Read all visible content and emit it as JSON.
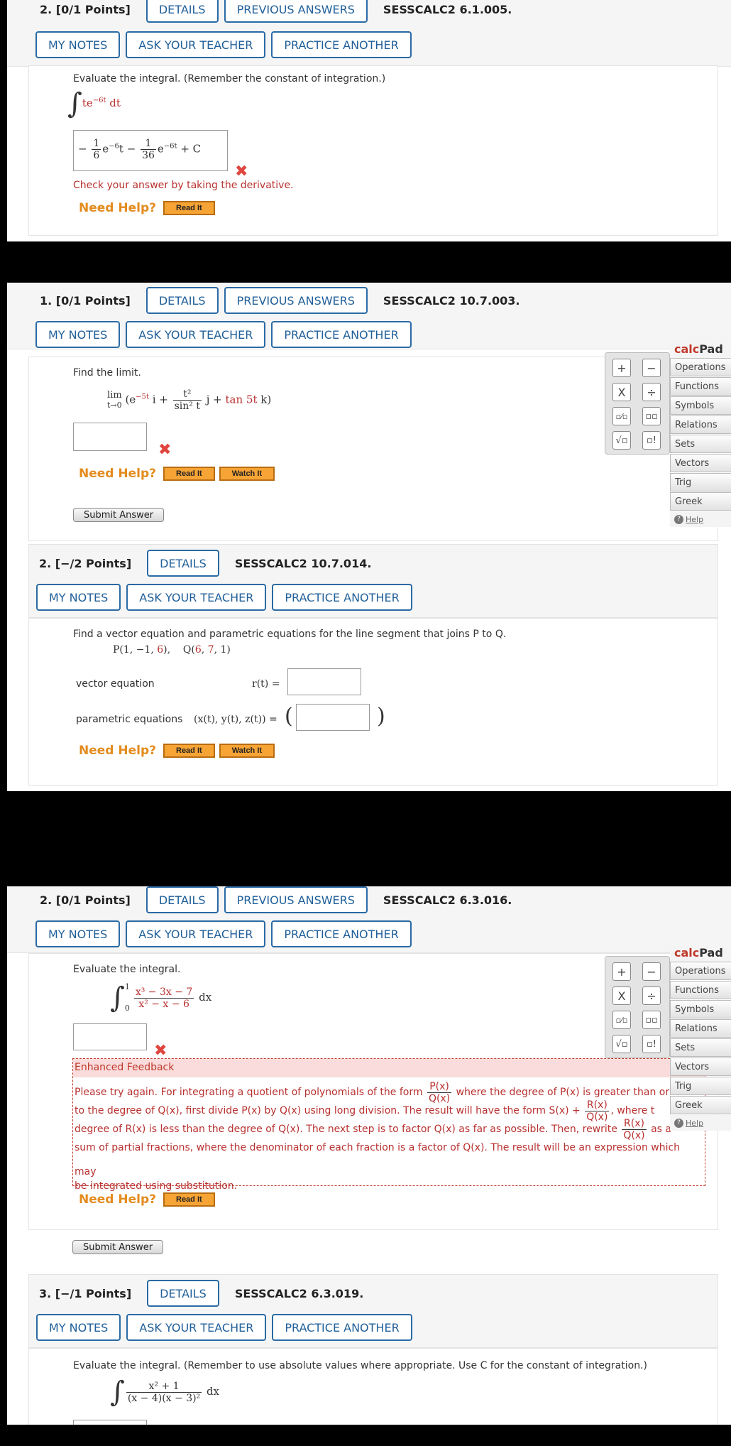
{
  "common": {
    "details": "DETAILS",
    "previous_answers": "PREVIOUS ANSWERS",
    "my_notes": "MY NOTES",
    "ask_teacher": "ASK YOUR TEACHER",
    "practice_another": "PRACTICE ANOTHER",
    "need_help": "Need Help?",
    "read_it": "Read It",
    "watch_it": "Watch It",
    "submit": "Submit Answer",
    "x_mark": "✖"
  },
  "calcpad": {
    "title_a": "calc",
    "title_b": "Pad",
    "menu": [
      "Operations",
      "Functions",
      "Symbols",
      "Relations",
      "Sets",
      "Vectors",
      "Trig",
      "Greek"
    ],
    "help": "Help",
    "keys": [
      "+",
      "−",
      "X",
      "÷",
      "▫⁄▫",
      "▫▫",
      "√▫",
      "▫!"
    ]
  },
  "q_a": {
    "points": "2. [0/1 Points]",
    "code": "SESSCALC2 6.1.005.",
    "prompt": "Evaluate the integral. (Remember the constant of integration.)",
    "integrand": "te",
    "integrand_exp": "−6t",
    "integrand_d": " dt",
    "answer_lead": "−",
    "answer_e1": "e",
    "answer_e1_exp": "−6",
    "answer_t": "t −",
    "answer_e2": "e",
    "answer_e2_exp": "−6t",
    "answer_c": " + C",
    "frac1_num": "1",
    "frac1_den": "6",
    "frac2_num": "1",
    "frac2_den": "36",
    "hint": "Check your answer by taking the derivative."
  },
  "q_b": {
    "points": "1. [0/1 Points]",
    "code": "SESSCALC2 10.7.003.",
    "prompt": "Find the limit.",
    "lim": "lim",
    "lim_sub": "t→0",
    "expr_open": "(e",
    "expr_exp": "−5t",
    "expr_i": " i +",
    "frac_num": "t²",
    "frac_den": "sin² t",
    "expr_j": " j + ",
    "expr_tan": "tan 5t",
    "expr_k": " k)"
  },
  "q_c": {
    "points": "2. [−/2 Points]",
    "code": "SESSCALC2 10.7.014.",
    "prompt": "Find a vector equation and parametric equations for the line segment that joins P to Q.",
    "points_text_p": "P(1, −1, ",
    "points_text_p6": "6",
    "points_text_pend": "),",
    "points_text_q": "Q(",
    "points_text_q6": "6",
    "points_text_qmid": ", ",
    "points_text_q7": "7",
    "points_text_qend": ", 1)",
    "vector_label": "vector equation",
    "vector_rhs": "r(t) =",
    "param_label": "parametric equations",
    "param_rhs": "(x(t), y(t), z(t)) ="
  },
  "q_d": {
    "points": "2. [0/1 Points]",
    "code": "SESSCALC2 6.3.016.",
    "prompt": "Evaluate the integral.",
    "upper": "1",
    "lower": "0",
    "num": "x³ − 3x − 7",
    "den": "x² − x − 6",
    "dx": " dx",
    "feedback_title": "Enhanced Feedback",
    "fb1": "Please try again. For integrating a quotient of polynomials of the form",
    "fb1b": "where the degree of P(x) is greater than or",
    "fb2": "to the degree of Q(x), first divide P(x) by Q(x) using long division. The result will have the form S(x) +",
    "fb2b": ", where t",
    "fb3": "degree of R(x) is less than the degree of Q(x). The next step is to factor Q(x) as far as possible. Then, rewrite",
    "fb3b": "as a",
    "fb4": "sum of partial fractions, where the denominator of each fraction is a factor of Q(x). The result will be an expression which may",
    "fb5": "be integrated using substitution.",
    "pq_num": "P(x)",
    "pq_den": "Q(x)",
    "rq_num": "R(x)",
    "rq_den": "Q(x)"
  },
  "q_e": {
    "points": "3. [−/1 Points]",
    "code": "SESSCALC2 6.3.019.",
    "prompt": "Evaluate the integral. (Remember to use absolute values where appropriate. Use C for the constant of integration.)",
    "num": "x² + 1",
    "den": "(x − 4)(x − 3)²",
    "dx": " dx"
  }
}
